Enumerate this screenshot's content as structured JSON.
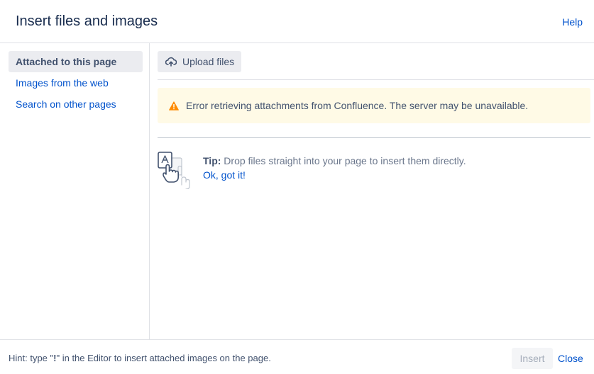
{
  "header": {
    "title": "Insert files and images",
    "help": "Help"
  },
  "sidebar": {
    "items": [
      {
        "label": "Attached to this page"
      },
      {
        "label": "Images from the web"
      },
      {
        "label": "Search on other pages"
      }
    ]
  },
  "toolbar": {
    "upload_label": "Upload files",
    "upload_icon": "cloud-upload-icon"
  },
  "warning": {
    "icon": "warning-icon",
    "text": "Error retrieving attachments from Confluence. The server may be unavailable.",
    "icon_color": "#ff8b00",
    "background": "#fffae6"
  },
  "tip": {
    "label": "Tip:",
    "text": " Drop files straight into your page to insert them directly.",
    "dismiss": "Ok, got it!",
    "illustration": "drag-file-hand-icon"
  },
  "footer": {
    "hint_prefix": "Hint: type \"",
    "hint_key": "!",
    "hint_suffix": "\" in the Editor to insert attached images on the page.",
    "insert_label": "Insert",
    "close_label": "Close"
  },
  "colors": {
    "link": "#0052cc",
    "text": "#42526e",
    "heading": "#172b4d",
    "selected_bg": "#ebecf0"
  }
}
